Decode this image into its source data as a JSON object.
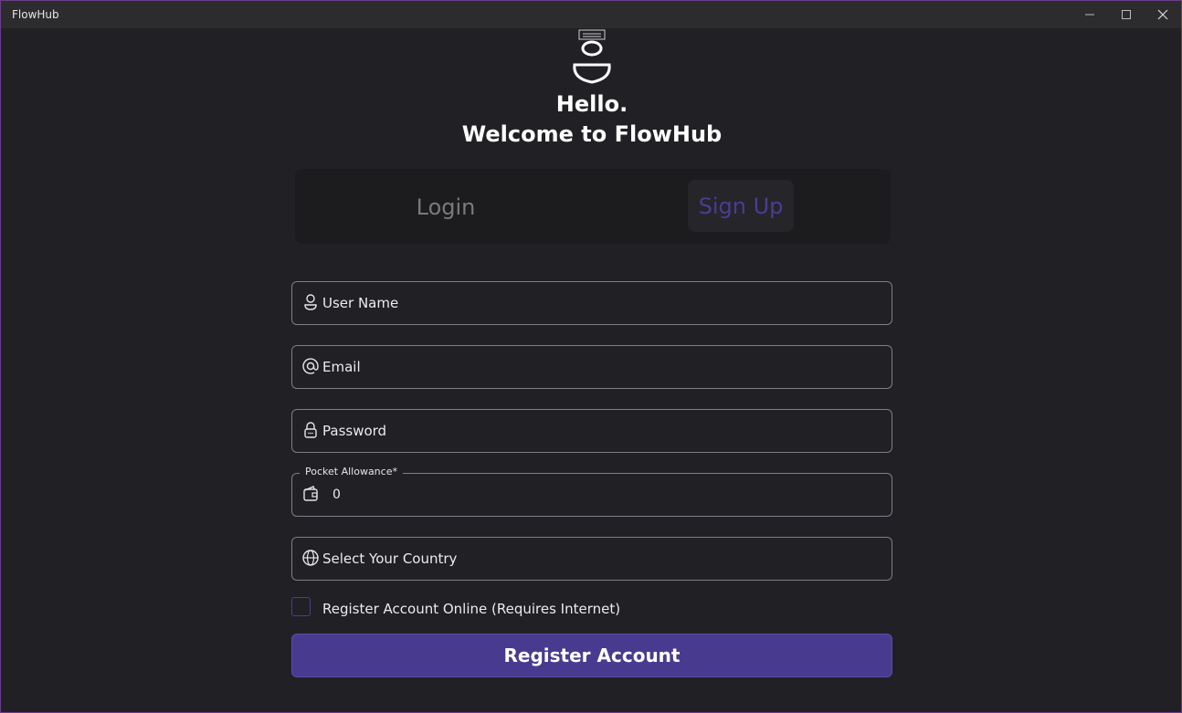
{
  "window": {
    "title": "FlowHub",
    "controls": [
      "minimize-icon",
      "maximize-icon",
      "close-icon"
    ]
  },
  "header": {
    "logo_icon": "user-avatar-icon",
    "greeting": "Hello.",
    "welcome": "Welcome to FlowHub"
  },
  "tabs": [
    {
      "label": "Login",
      "active": false
    },
    {
      "label": "Sign Up",
      "active": true
    }
  ],
  "form": {
    "username": {
      "placeholder": "User Name",
      "icon": "user-icon"
    },
    "email": {
      "placeholder": "Email",
      "icon": "at-sign-icon"
    },
    "password": {
      "placeholder": "Password",
      "icon": "lock-icon"
    },
    "allowance": {
      "label": "Pocket Allowance*",
      "value": "0",
      "icon": "wallet-icon"
    },
    "country": {
      "placeholder": "Select Your Country",
      "icon": "globe-icon"
    },
    "online_checkbox": {
      "label": "Register Account Online (Requires Internet)",
      "checked": false
    },
    "submit_label": "Register Account"
  },
  "colors": {
    "background": "#202025",
    "accent": "#483b8f",
    "tab_active_text": "#4a3d93",
    "border": "#7e7e86"
  }
}
